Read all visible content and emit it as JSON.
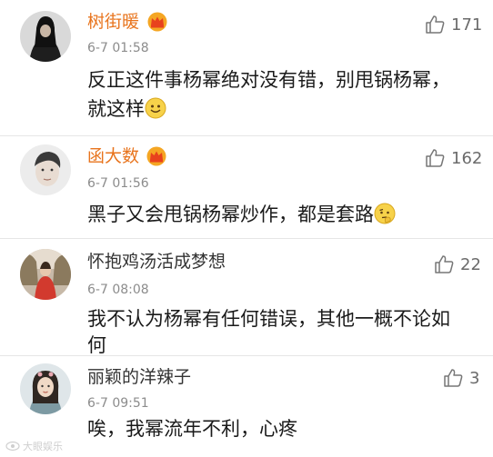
{
  "accent_color": "#e8741d",
  "comments": [
    {
      "username": "树街暖",
      "username_color": "#e8741d",
      "vip_badge": "crown-icon",
      "time": "6-7 01:58",
      "text_line1": "反正这件事杨幂绝对没有错，别甩锅杨幂，",
      "text_line2": "就这样",
      "emoji": "smile-emoji-icon",
      "likes": "171"
    },
    {
      "username": "函大数",
      "username_color": "#e8741d",
      "vip_badge": "crown-icon",
      "time": "6-7 01:56",
      "text_line1": "黑子又会甩锅杨幂炒作，都是套路",
      "emoji": "thinking-emoji-icon",
      "likes": "162"
    },
    {
      "username": "怀抱鸡汤活成梦想",
      "username_color": "#333333",
      "time": "6-7 08:08",
      "text_line1": "我不认为杨幂有任何错误，其他一概不论如",
      "text_line2": "何",
      "likes": "22"
    },
    {
      "username": "丽颖的洋辣子",
      "username_color": "#333333",
      "time": "6-7 09:51",
      "text_line1": "唉，我幂流年不利，心疼",
      "likes": "3"
    }
  ],
  "watermark": "大眼娱乐"
}
